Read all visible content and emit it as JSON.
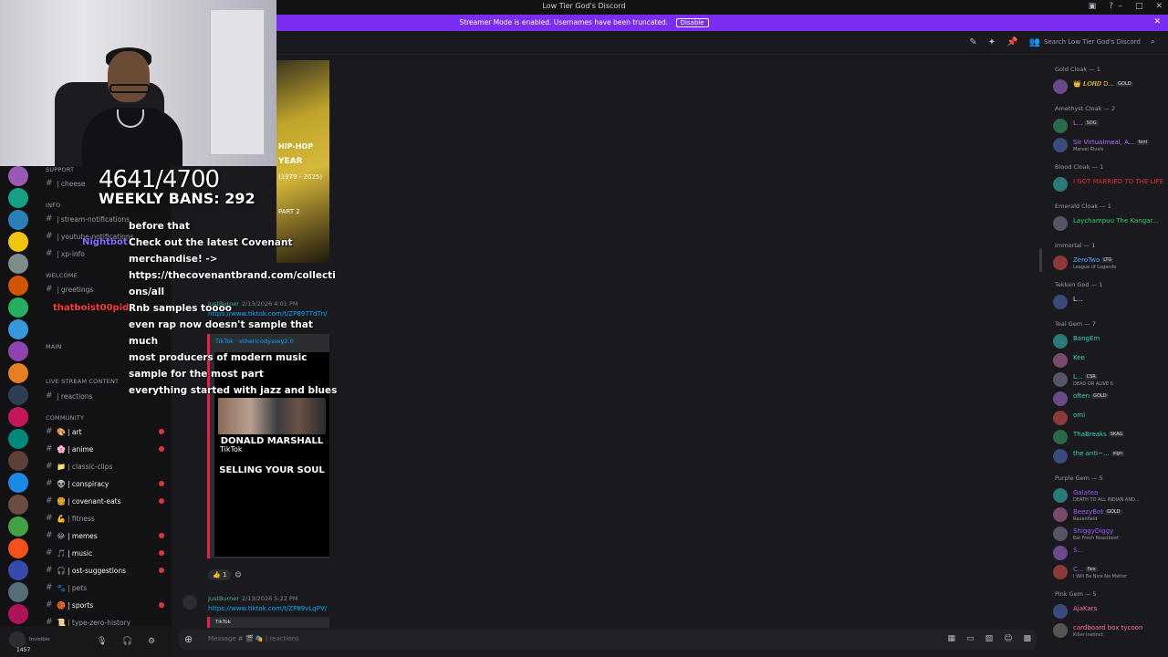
{
  "window": {
    "title": "Low Tier God's Discord"
  },
  "streamer_bar": {
    "message": "Streamer Mode is enabled. Usernames have been truncated.",
    "disable_label": "Disable",
    "close": "✕"
  },
  "header": {
    "search_placeholder": "Search Low Tier God's Discord"
  },
  "overlay": {
    "count": "4641/4700",
    "bans": "WEEKLY BANS: 292"
  },
  "chat_overlay": [
    {
      "name": "",
      "text": "before that"
    },
    {
      "name": "Nightbot",
      "text": "Check out the latest Covenant"
    },
    {
      "name": "",
      "text": "merchandise! ->"
    },
    {
      "name": "",
      "text": "https://thecovenantbrand.com/collecti"
    },
    {
      "name": "",
      "text": "ons/all"
    },
    {
      "name": "thatboist00pid",
      "text": "Rnb samples toooo"
    },
    {
      "name": "",
      "text": "even rap now doesn't sample that"
    },
    {
      "name": "",
      "text": "much"
    },
    {
      "name": "",
      "text": "most producers of modern music"
    },
    {
      "name": "",
      "text": "sample for the most part"
    },
    {
      "name": "",
      "text": "everything started with jazz and blues"
    }
  ],
  "channel_categories": [
    {
      "name": "SUPPORT"
    },
    {
      "name": "INFO"
    },
    {
      "name": "WELCOME"
    },
    {
      "name": "MAIN"
    },
    {
      "name": "LIVE STREAM CONTENT"
    },
    {
      "name": "COMMUNITY"
    }
  ],
  "channels_top": [
    {
      "label": "| cheese"
    },
    {
      "label": "| stream-notifications"
    },
    {
      "label": "| youtube-notifications"
    },
    {
      "label": "| xp-info"
    },
    {
      "label": "| greetings"
    },
    {
      "label": "| reactions"
    }
  ],
  "channels": [
    {
      "label": "| art",
      "unread": true
    },
    {
      "label": "| anime",
      "unread": true
    },
    {
      "label": "| classic-clips",
      "unread": false
    },
    {
      "label": "| conspiracy",
      "unread": true
    },
    {
      "label": "| covenant-eats",
      "unread": true
    },
    {
      "label": "| fitness",
      "unread": false
    },
    {
      "label": "| memes",
      "unread": true
    },
    {
      "label": "| music",
      "unread": true
    },
    {
      "label": "| ost-suggestions",
      "unread": true
    },
    {
      "label": "| pets",
      "unread": false
    },
    {
      "label": "| sports",
      "unread": true
    },
    {
      "label": "| type-zero-history",
      "unread": false
    }
  ],
  "user_panel": {
    "status": "Invisible",
    "count": "1457"
  },
  "media1": {
    "l1": "HIP-HOP",
    "l2": "YEAR",
    "l3": "(1979 - 2025)",
    "l4": "PART 2"
  },
  "messages": [
    {
      "author": "JustBurner",
      "time": "2/13/2026 4:01 PM",
      "link": "https://www.tiktok.com/t/ZP897TdTn/",
      "provider": "TikTok · ethericodyssey2.0"
    },
    {
      "author": "JustBurner",
      "time": "2/13/2026 5:22 PM",
      "link": "https://www.tiktok.com/t/ZP89vLqPV/",
      "provider": "TikTok"
    }
  ],
  "video": {
    "line1": "DONALD MARSHALL",
    "line2": "SELLING YOUR SOUL",
    "brand": "TikTok"
  },
  "reaction": {
    "emoji": "👍",
    "count": "1"
  },
  "composer": {
    "placeholder": "Message # 🎬 🎭 | reactions"
  },
  "members": [
    {
      "cat": "Gold Cloak — 1"
    },
    {
      "name": "👑 𝑳𝑶𝑹𝑫 D...",
      "tag": "GOLD",
      "color": "#f0c020"
    },
    {
      "cat": "Amethyst Cloak — 2"
    },
    {
      "name": "L...",
      "tag": "SOG",
      "color": "#b06cff"
    },
    {
      "name": "Sir Virtualmeal, A...",
      "sub": "Marvel Rivals",
      "tag": "fent",
      "color": "#b06cff"
    },
    {
      "cat": "Blood Cloak — 1"
    },
    {
      "name": "I GOT MARRIED TO THE LIFE",
      "color": "#e0303a"
    },
    {
      "cat": "Emerald Cloak — 1"
    },
    {
      "name": "Laychampuu The Kangar...",
      "color": "#2bd06e"
    },
    {
      "cat": "Immortal — 1"
    },
    {
      "name": "ZeroTwo",
      "sub": "League of Legends",
      "tag": "LTG",
      "color": "#4aa3ff"
    },
    {
      "cat": "Tekken God — 1"
    },
    {
      "name": "L...",
      "color": "#dbdee1"
    },
    {
      "cat": "Teal Gem — 7"
    },
    {
      "name": "BangEm",
      "color": "#30d0c0"
    },
    {
      "name": "Kee",
      "color": "#30d0c0"
    },
    {
      "name": "L...",
      "sub": "DEAD OR ALIVE 6",
      "tag": "CSR",
      "color": "#30d0c0"
    },
    {
      "name": "often",
      "tag": "GOLD",
      "color": "#30d0c0"
    },
    {
      "name": "omi",
      "color": "#30d0c0"
    },
    {
      "name": "ThaBreaks",
      "tag": "SKAG",
      "color": "#30d0c0"
    },
    {
      "name": "the anti~...",
      "tag": "sign",
      "color": "#30d0c0"
    },
    {
      "cat": "Purple Gem — 5"
    },
    {
      "name": "Galatea",
      "sub": "DEATH TO ALL INDIAN AND...",
      "color": "#9b59ff"
    },
    {
      "name": "BeezyBot",
      "sub": "Ravenfield",
      "tag": "GOLD",
      "color": "#9b59ff"
    },
    {
      "name": "ShiggyDiggy",
      "sub": "Eat Fresh Roastbeef",
      "color": "#9b59ff"
    },
    {
      "name": "S...",
      "color": "#9b59ff"
    },
    {
      "name": "C...",
      "sub": "I Will Be Nice No Matter",
      "tag": "flex",
      "color": "#9b59ff"
    },
    {
      "cat": "Pink Gem — 5"
    },
    {
      "name": "AjaKars",
      "color": "#ff6ab0"
    },
    {
      "name": "cardboard box tycoon",
      "sub": "Killer instinct",
      "color": "#ff6ab0"
    }
  ]
}
